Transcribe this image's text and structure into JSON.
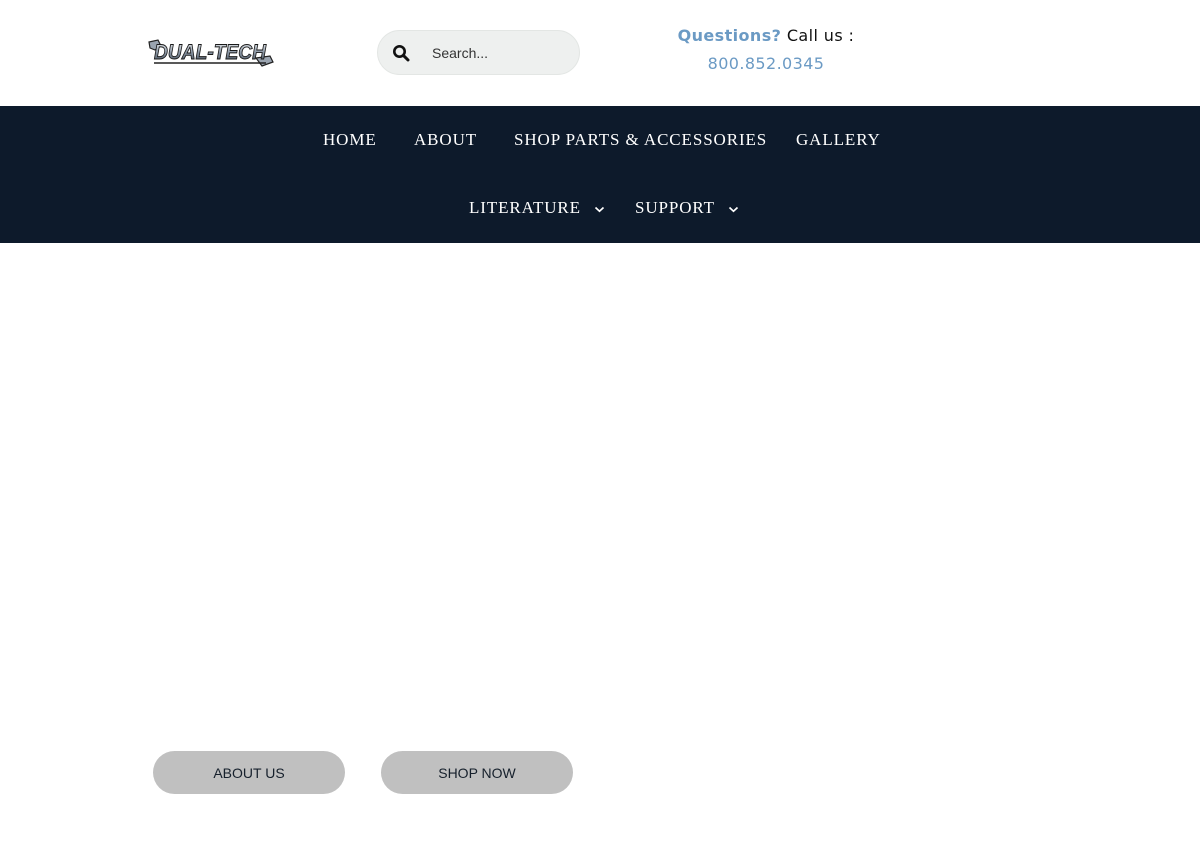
{
  "header": {
    "logo": {
      "text": "DUAL-TECH",
      "icon": "dual-tech-logo"
    },
    "search": {
      "placeholder": "Search...",
      "value": "",
      "icon": "search-icon"
    },
    "contact": {
      "questions_label": "Questions?",
      "call_label": "Call us :",
      "phone": "800.852.0345"
    }
  },
  "nav": {
    "items": [
      {
        "label": "HOME"
      },
      {
        "label": "ABOUT"
      },
      {
        "label": "SHOP PARTS & ACCESSORIES"
      },
      {
        "label": "GALLERY"
      },
      {
        "label": "LITERATURE",
        "dropdown": true
      },
      {
        "label": "SUPPORT",
        "dropdown": true
      }
    ]
  },
  "hero": {
    "buttons": [
      {
        "label": "ABOUT US"
      },
      {
        "label": "SHOP NOW"
      }
    ]
  },
  "colors": {
    "navbar_bg": "#0d1a2b",
    "accent_blue": "#6b9ac4",
    "button_bg": "#c0c0c0",
    "search_bg": "#eef0ef"
  }
}
